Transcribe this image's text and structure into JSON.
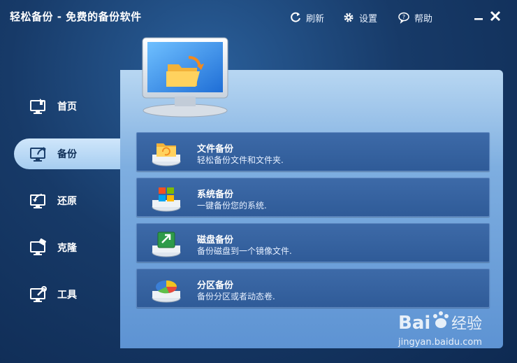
{
  "window": {
    "title": "轻松备份 - 免费的备份软件",
    "actions": {
      "refresh": "刷新",
      "settings": "设置",
      "help": "帮助"
    }
  },
  "sidebar": {
    "items": [
      {
        "label": "首页",
        "icon": "home-monitor-icon"
      },
      {
        "label": "备份",
        "icon": "backup-monitor-icon",
        "active": true
      },
      {
        "label": "还原",
        "icon": "restore-monitor-icon"
      },
      {
        "label": "克隆",
        "icon": "clone-monitor-icon"
      },
      {
        "label": "工具",
        "icon": "tools-monitor-icon"
      }
    ]
  },
  "main": {
    "header_icon": "backup-monitor-large-icon",
    "cards": [
      {
        "title": "文件备份",
        "desc": "轻松备份文件和文件夹.",
        "icon": "file-backup-icon"
      },
      {
        "title": "系统备份",
        "desc": "一键备份您的系统.",
        "icon": "system-backup-icon"
      },
      {
        "title": "磁盘备份",
        "desc": "备份磁盘到一个镜像文件.",
        "icon": "disk-backup-icon"
      },
      {
        "title": "分区备份",
        "desc": "备份分区或者动态卷.",
        "icon": "partition-backup-icon"
      }
    ]
  },
  "watermark": {
    "brand": "Bai",
    "brand2": "经验",
    "url": "jingyan.baidu.com"
  },
  "colors": {
    "background": "#173a68",
    "panel": "#7eaee0",
    "card": "#3d6aa8",
    "active_nav": "#cfe6fb"
  }
}
